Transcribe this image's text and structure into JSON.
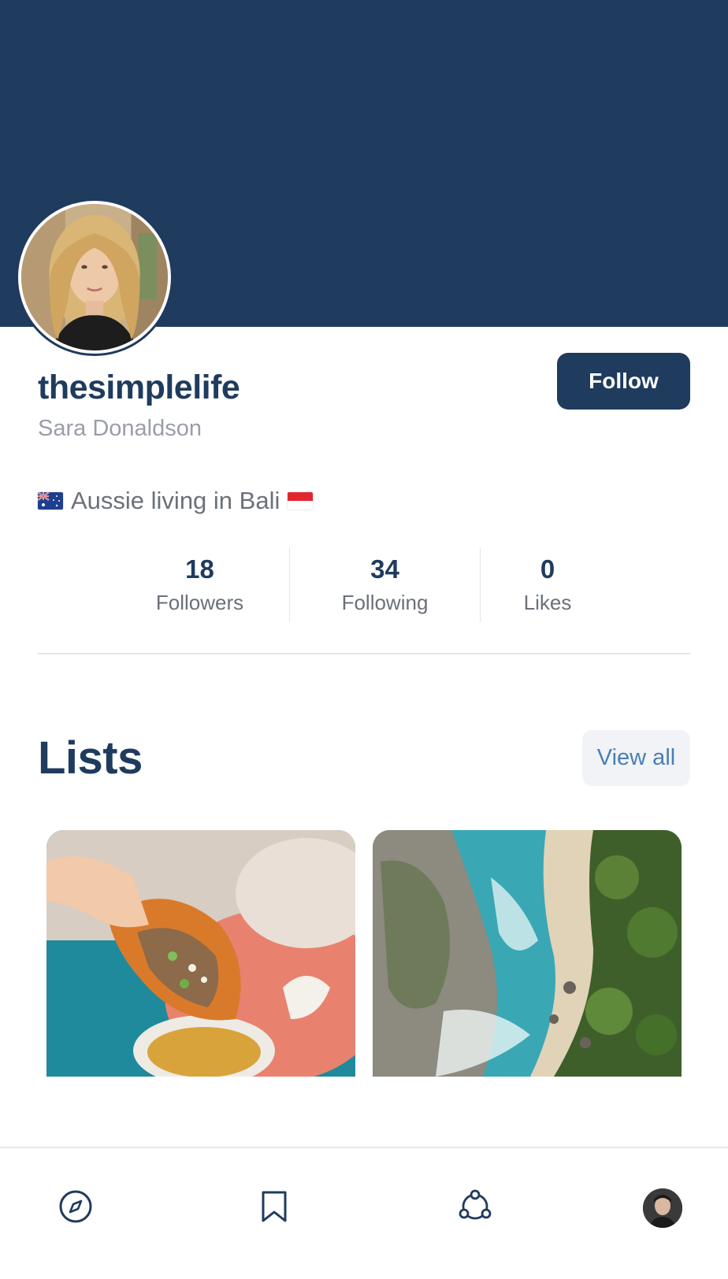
{
  "profile": {
    "username": "thesimplelife",
    "full_name": "Sara Donaldson",
    "follow_label": "Follow",
    "bio": {
      "text": "Aussie living in Bali",
      "flag_left": "australia-flag",
      "flag_right": "indonesia-flag"
    }
  },
  "stats": [
    {
      "value": "18",
      "label": "Followers"
    },
    {
      "value": "34",
      "label": "Following"
    },
    {
      "value": "0",
      "label": "Likes"
    }
  ],
  "lists_section": {
    "title": "Lists",
    "view_all_label": "View all",
    "cards": [
      {
        "image": "taco-photo"
      },
      {
        "image": "bali-beach-aerial-photo"
      }
    ]
  },
  "bottom_nav": {
    "items": [
      {
        "icon": "compass-icon"
      },
      {
        "icon": "bookmark-icon"
      },
      {
        "icon": "community-icon"
      },
      {
        "icon": "profile-avatar"
      }
    ]
  },
  "colors": {
    "primary": "#1f3b5e",
    "muted_text": "#6b7079",
    "light_text": "#9a9ea6",
    "link": "#4a7fb5",
    "chip_bg": "#f1f3f6",
    "divider": "#e3e5e8"
  }
}
